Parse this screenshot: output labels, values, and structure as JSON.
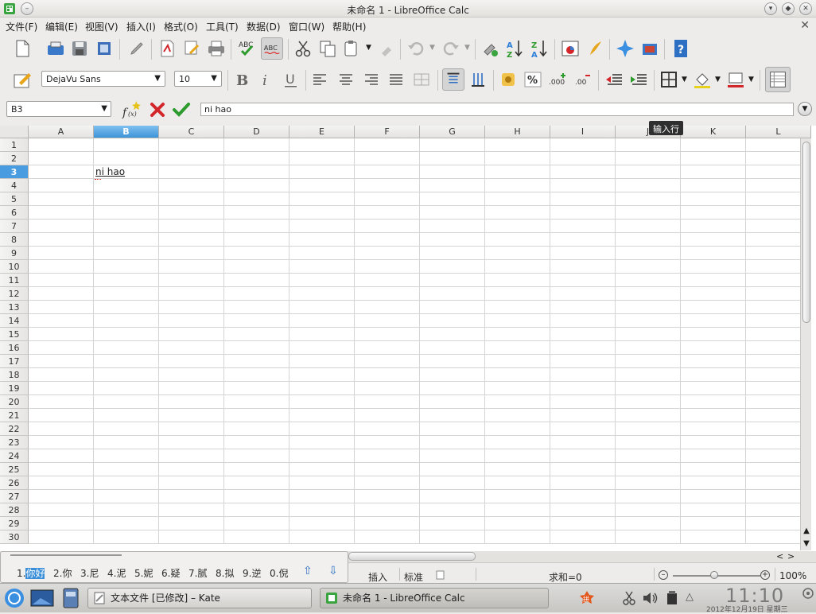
{
  "window": {
    "title": "未命名 1 - LibreOffice Calc"
  },
  "menu": [
    "文件(F)",
    "编辑(E)",
    "视图(V)",
    "插入(I)",
    "格式(O)",
    "工具(T)",
    "数据(D)",
    "窗口(W)",
    "帮助(H)"
  ],
  "format_bar": {
    "font_name": "DejaVu Sans",
    "font_size": "10"
  },
  "formula_bar": {
    "cell_ref": "B3",
    "content": "ni hao",
    "tooltip": "输入行"
  },
  "columns": [
    "A",
    "B",
    "C",
    "D",
    "E",
    "F",
    "G",
    "H",
    "I",
    "J",
    "K",
    "L"
  ],
  "selected_column": "B",
  "rows": [
    "1",
    "2",
    "3",
    "4",
    "5",
    "6",
    "7",
    "8",
    "9",
    "10",
    "11",
    "12",
    "13",
    "14",
    "15",
    "16",
    "17",
    "18",
    "19",
    "20",
    "21",
    "22",
    "23",
    "24",
    "25",
    "26",
    "27",
    "28",
    "29",
    "30"
  ],
  "selected_row": "3",
  "cells": {
    "B3": "ni hao"
  },
  "ime": {
    "candidates": [
      "1.你好",
      "2.你",
      "3.尼",
      "4.泥",
      "5.妮",
      "6.疑",
      "7.腻",
      "8.拟",
      "9.逆",
      "0.倪"
    ]
  },
  "status": {
    "mode": "插入",
    "selection": "标准",
    "sum": "求和=0",
    "zoom": "100%"
  },
  "taskbar": {
    "tasks": [
      "文本文件 [已修改] – Kate",
      "未命名 1 - LibreOffice Calc"
    ],
    "clock": "11:10",
    "date": "2012年12月19日 星期三"
  },
  "colors": {
    "selection": "#3d94d8",
    "accent_icon": "#2b6fc2"
  }
}
